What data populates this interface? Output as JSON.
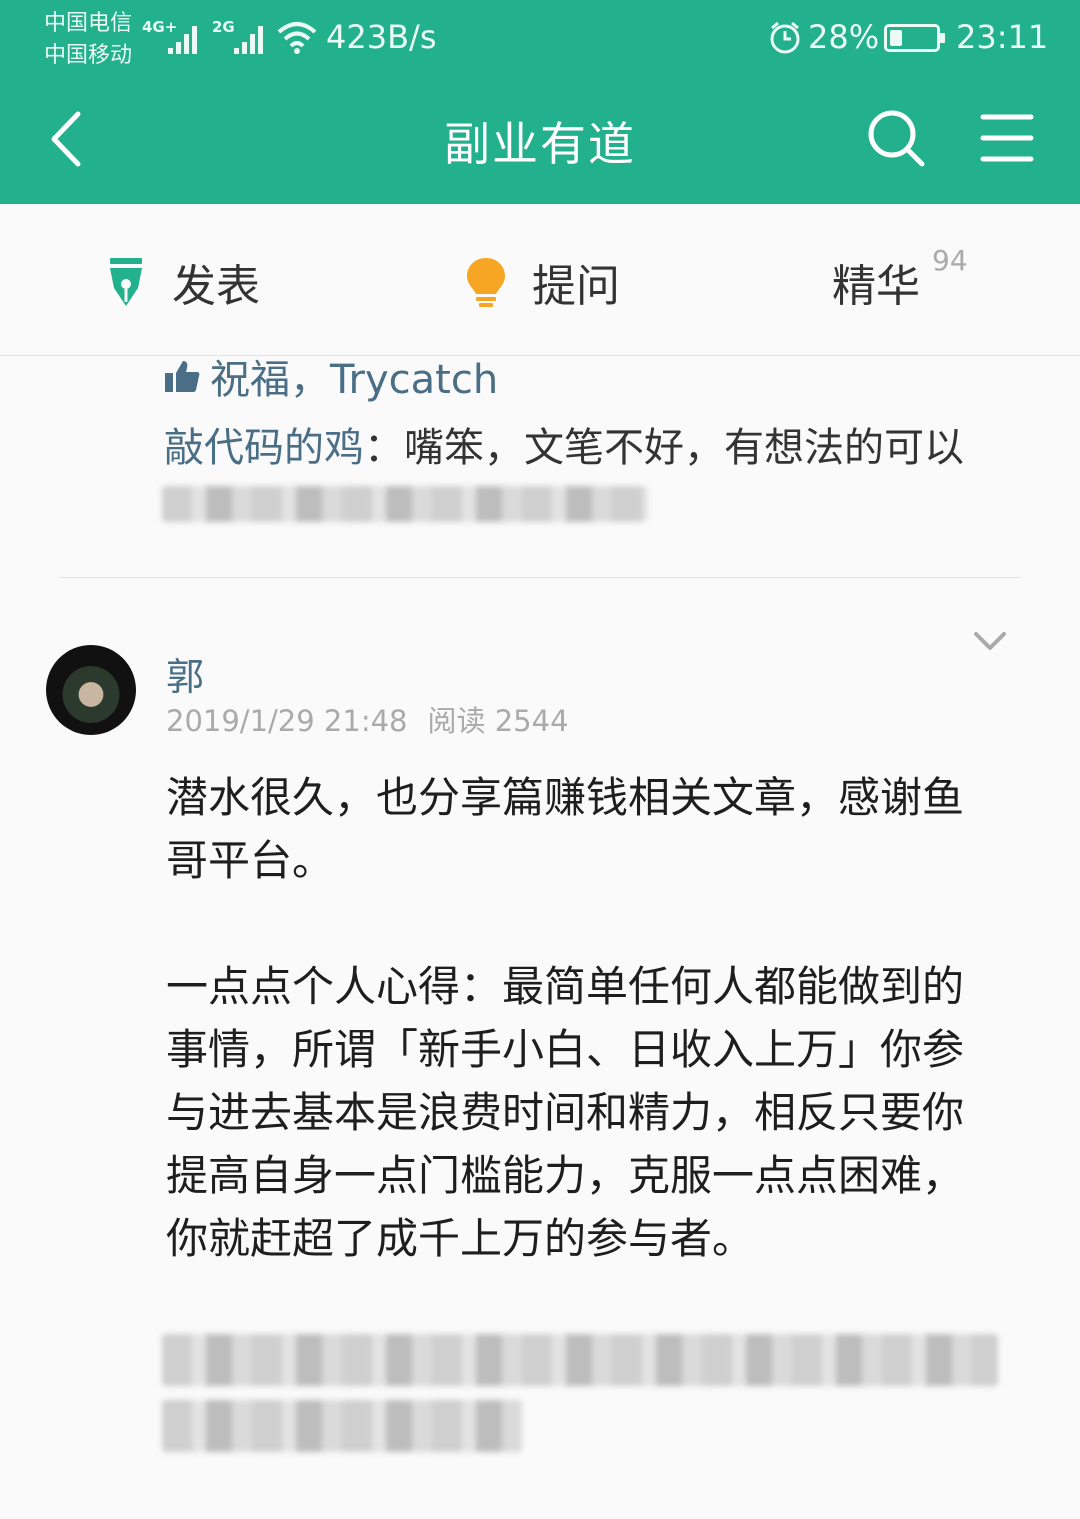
{
  "status_bar": {
    "carrier_1": "中国电信",
    "carrier_2": "中国移动",
    "net_1": "4G+",
    "net_2": "2G",
    "speed": "423B/s",
    "battery": "28%",
    "battery_level": 0.28,
    "time": "23:11"
  },
  "nav": {
    "title": "副业有道"
  },
  "actions": {
    "post": "发表",
    "ask": "提问",
    "best": "精华",
    "best_count": "94"
  },
  "prev_comment": {
    "likes": "祝福，Trycatch",
    "commenter": "敲代码的鸡",
    "separator": "：",
    "text": "嘴笨，文笔不好，有想法的可以"
  },
  "post": {
    "author": "郭",
    "date": "2019/1/29 21:48",
    "reads": "阅读 2544",
    "paragraph_1": "潜水很久，也分享篇赚钱相关文章，感谢鱼哥平台。",
    "paragraph_2": "一点点个人心得：最简单任何人都能做到的事情，所谓「新手小白、日收入上万」你参与进去基本是浪费时间和精力，相反只要你提高自身一点门槛能力，克服一点点困难，你就赶超了成千上万的参与者。"
  },
  "colors": {
    "brand": "#23b08c",
    "link": "#4a6e86"
  }
}
